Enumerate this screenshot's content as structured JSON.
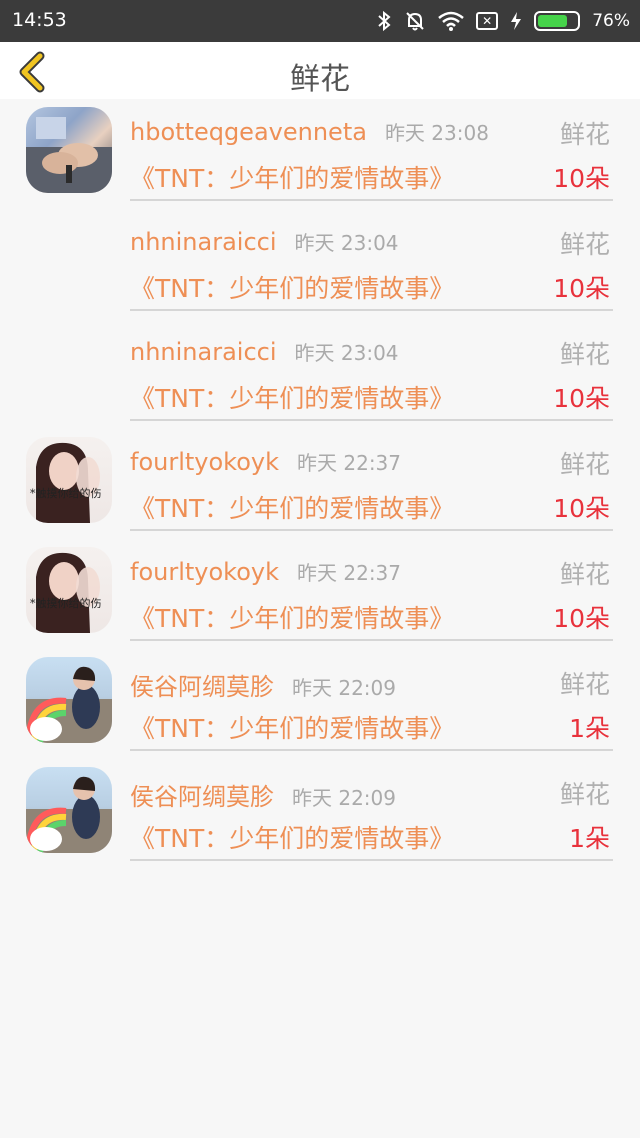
{
  "status_bar": {
    "time": "14:53",
    "battery_percent": "76%",
    "battery_level": 0.76,
    "battery_color": "#46d34a",
    "icons": [
      "bluetooth-icon",
      "mute-bell-icon",
      "wifi-icon",
      "sim-icon",
      "charging-icon",
      "battery-icon"
    ]
  },
  "header": {
    "title": "鲜花",
    "back_icon": "chevron-left-icon",
    "accent_color": "#f0c420"
  },
  "colors": {
    "name": "#ee8f55",
    "count": "#e8323c",
    "muted": "#aaaaaa"
  },
  "records": [
    {
      "name": "hbotteqgeavenneta",
      "time": "昨天 23:08",
      "gift": "鲜花",
      "book": "《TNT：少年们的爱情故事》",
      "count": "10朵",
      "avatar": "hand-photo"
    },
    {
      "name": "nhninaraicci",
      "time": "昨天 23:04",
      "gift": "鲜花",
      "book": "《TNT：少年们的爱情故事》",
      "count": "10朵",
      "avatar": ""
    },
    {
      "name": "nhninaraicci",
      "time": "昨天 23:04",
      "gift": "鲜花",
      "book": "《TNT：少年们的爱情故事》",
      "count": "10朵",
      "avatar": ""
    },
    {
      "name": "fourltyokoyk",
      "time": "昨天 22:37",
      "gift": "鲜花",
      "book": "《TNT：少年们的爱情故事》",
      "count": "10朵",
      "avatar": "girl-photo",
      "avatar_text": "*触摸你给的伤"
    },
    {
      "name": "fourltyokoyk",
      "time": "昨天 22:37",
      "gift": "鲜花",
      "book": "《TNT：少年们的爱情故事》",
      "count": "10朵",
      "avatar": "girl-photo",
      "avatar_text": "*触摸你给的伤"
    },
    {
      "name": "侯谷阿绸莫胗",
      "time": "昨天 22:09",
      "gift": "鲜花",
      "book": "《TNT：少年们的爱情故事》",
      "count": "1朵",
      "avatar": "rainbow-photo"
    },
    {
      "name": "侯谷阿绸莫胗",
      "time": "昨天 22:09",
      "gift": "鲜花",
      "book": "《TNT：少年们的爱情故事》",
      "count": "1朵",
      "avatar": "rainbow-photo"
    }
  ]
}
